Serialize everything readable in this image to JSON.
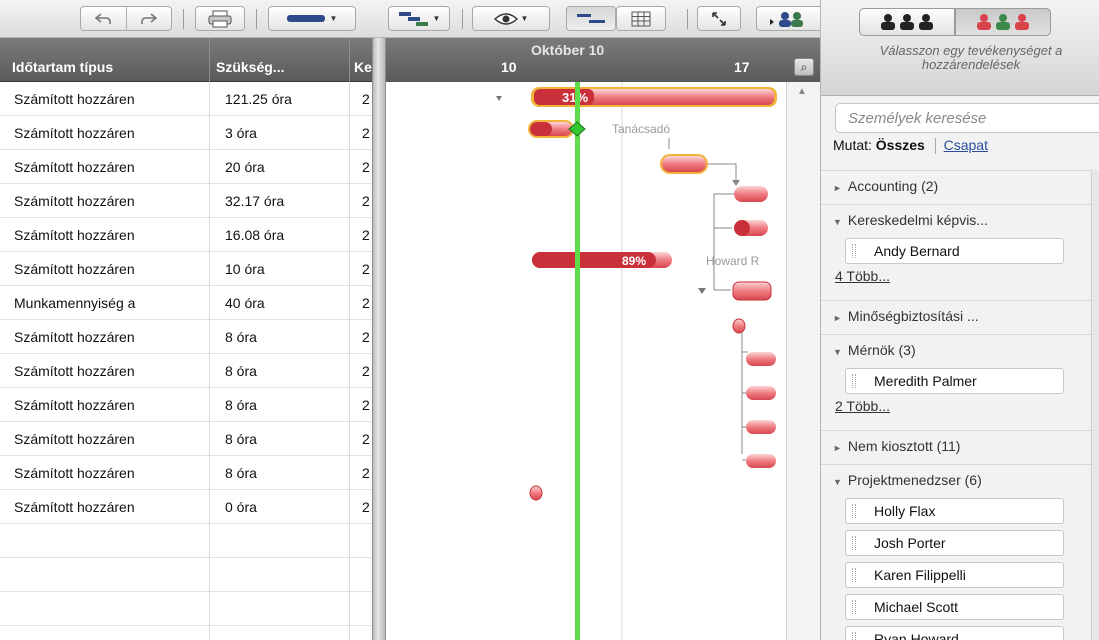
{
  "toolbar": {
    "undo_icon": "undo-icon",
    "redo_icon": "redo-icon",
    "print_icon": "print-icon",
    "view_icon": "eye-icon"
  },
  "grid": {
    "columns": [
      "Időtartam típus",
      "Szükség...",
      "Ke"
    ],
    "rows": [
      {
        "type": "Számított hozzáren",
        "need": "121.25 óra",
        "k": "2"
      },
      {
        "type": "Számított hozzáren",
        "need": "3 óra",
        "k": "2"
      },
      {
        "type": "Számított hozzáren",
        "need": "20 óra",
        "k": "2"
      },
      {
        "type": "Számított hozzáren",
        "need": "32.17 óra",
        "k": "2"
      },
      {
        "type": "Számított hozzáren",
        "need": "16.08 óra",
        "k": "2"
      },
      {
        "type": "Számított hozzáren",
        "need": "10 óra",
        "k": "2"
      },
      {
        "type": "Munkamennyiség a",
        "need": "40 óra",
        "k": "2"
      },
      {
        "type": "Számított hozzáren",
        "need": "8 óra",
        "k": "2"
      },
      {
        "type": "Számított hozzáren",
        "need": "8 óra",
        "k": "2"
      },
      {
        "type": "Számított hozzáren",
        "need": "8 óra",
        "k": "2"
      },
      {
        "type": "Számított hozzáren",
        "need": "8 óra",
        "k": "2"
      },
      {
        "type": "Számított hozzáren",
        "need": "8 óra",
        "k": "2"
      },
      {
        "type": "Számított hozzáren",
        "need": "0 óra",
        "k": "2"
      },
      {
        "type": "",
        "need": "",
        "k": ""
      },
      {
        "type": "",
        "need": "",
        "k": ""
      },
      {
        "type": "",
        "need": "",
        "k": ""
      },
      {
        "type": "",
        "need": "",
        "k": ""
      }
    ]
  },
  "gantt": {
    "month": "Október 10",
    "days": [
      "10",
      "17"
    ],
    "bar1_label": "31%",
    "bar6_label": "89%",
    "label_tanacsado": "Tanácsadó",
    "label_howard": "Howard R",
    "bar_color": "#d9434a",
    "today_line_color": "#5fdc4a"
  },
  "right_panel": {
    "hint": "Válasszon egy tevékenységet a hozzárendelések",
    "search_placeholder": "Személyek keresése",
    "show_label": "Mutat:",
    "show_all": "Összes",
    "show_team": "Csapat",
    "groups": [
      {
        "label": "Accounting (2)",
        "expanded": false
      },
      {
        "label": "Kereskedelmi képvis...",
        "expanded": true,
        "people": [
          "Andy Bernard"
        ],
        "more": "4 Több..."
      },
      {
        "label": "Minőségbiztosítási ...",
        "expanded": false
      },
      {
        "label": "Mérnök (3)",
        "expanded": true,
        "people": [
          "Meredith Palmer"
        ],
        "more": "2 Több..."
      },
      {
        "label": "Nem kiosztott (11)",
        "expanded": false
      },
      {
        "label": "Projektmenedzser (6)",
        "expanded": true,
        "people": [
          "Holly Flax",
          "Josh Porter",
          "Karen Filippelli",
          "Michael Scott",
          "Ryan Howard"
        ]
      }
    ]
  }
}
